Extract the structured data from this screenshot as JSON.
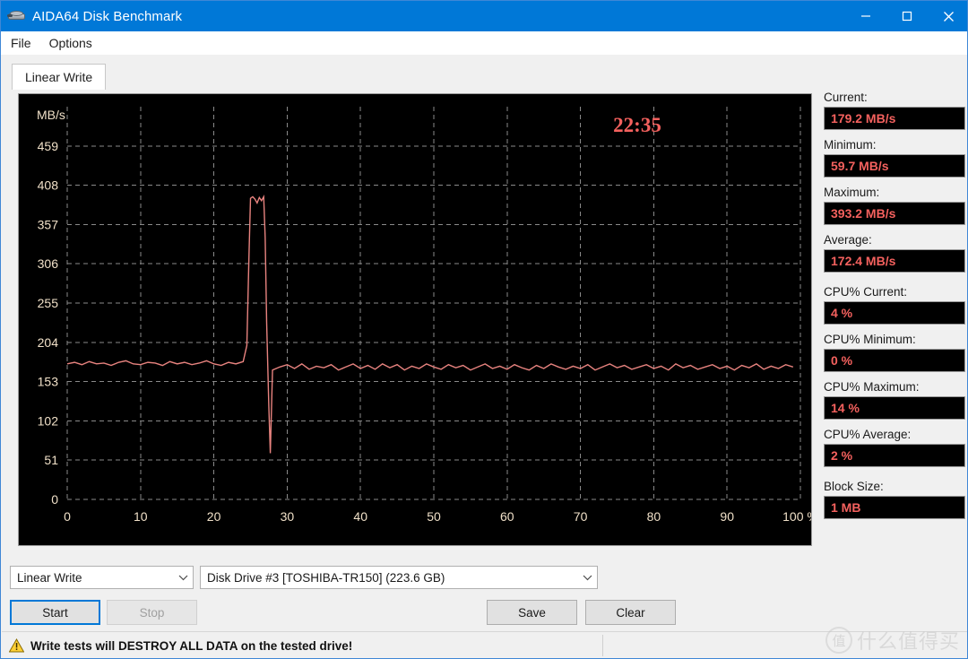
{
  "window": {
    "title": "AIDA64 Disk Benchmark",
    "icon": "disk-drive-icon",
    "minimize_label": "—",
    "maximize_label": "☐",
    "close_label": "✕",
    "titlebar_color": "#0078d7"
  },
  "menu": {
    "items": [
      {
        "label": "File"
      },
      {
        "label": "Options"
      }
    ]
  },
  "tabs": [
    {
      "label": "Linear Write",
      "active": true
    }
  ],
  "chart_data": {
    "type": "line",
    "title": "",
    "timer": "22:35",
    "xlabel": "",
    "ylabel": "MB/s",
    "x_unit": "%",
    "xlim": [
      0,
      100
    ],
    "ylim": [
      0,
      510
    ],
    "grid": true,
    "x_ticks": [
      0,
      10,
      20,
      30,
      40,
      50,
      60,
      70,
      80,
      90,
      100
    ],
    "x_tick_labels": [
      "0",
      "10",
      "20",
      "30",
      "40",
      "50",
      "60",
      "70",
      "80",
      "90",
      "100 %"
    ],
    "y_ticks": [
      0,
      51,
      102,
      153,
      204,
      255,
      306,
      357,
      408,
      459
    ],
    "y_tick_labels": [
      "0",
      "51",
      "102",
      "153",
      "204",
      "255",
      "306",
      "357",
      "408",
      "459"
    ],
    "line_color": "#e8837f",
    "background": "#000000",
    "grid_color": "#8a8a8a",
    "series": [
      {
        "name": "Linear Write",
        "x": [
          0,
          1,
          2,
          3,
          4,
          5,
          6,
          7,
          8,
          9,
          10,
          11,
          12,
          13,
          14,
          15,
          16,
          17,
          18,
          19,
          20,
          21,
          22,
          23,
          24,
          24.5,
          24.8,
          25.0,
          25.3,
          25.6,
          25.9,
          26.2,
          26.5,
          26.8,
          27.0,
          27.2,
          27.35,
          27.5,
          27.7,
          28,
          29,
          30,
          31,
          32,
          33,
          34,
          35,
          36,
          37,
          38,
          39,
          40,
          41,
          42,
          43,
          44,
          45,
          46,
          47,
          48,
          49,
          50,
          51,
          52,
          53,
          54,
          55,
          56,
          57,
          58,
          59,
          60,
          61,
          62,
          63,
          64,
          65,
          66,
          67,
          68,
          69,
          70,
          71,
          72,
          73,
          74,
          75,
          76,
          77,
          78,
          79,
          80,
          81,
          82,
          83,
          84,
          85,
          86,
          87,
          88,
          89,
          90,
          91,
          92,
          93,
          94,
          95,
          96,
          97,
          98,
          99,
          100
        ],
        "y": [
          176,
          178,
          175,
          179,
          176,
          177,
          174,
          178,
          180,
          176,
          175,
          178,
          177,
          174,
          179,
          176,
          178,
          175,
          177,
          180,
          176,
          174,
          178,
          176,
          179,
          200,
          320,
          391,
          393,
          390,
          385,
          392,
          388,
          393,
          340,
          230,
          175,
          120,
          60,
          168,
          172,
          175,
          170,
          176,
          169,
          173,
          171,
          175,
          168,
          172,
          176,
          170,
          174,
          169,
          176,
          171,
          175,
          168,
          173,
          170,
          176,
          172,
          169,
          175,
          171,
          174,
          168,
          172,
          176,
          170,
          173,
          169,
          175,
          171,
          168,
          174,
          170,
          176,
          172,
          169,
          173,
          170,
          175,
          168,
          172,
          176,
          171,
          174,
          169,
          172,
          175,
          170,
          173,
          168,
          176,
          171,
          174,
          169,
          172,
          175,
          170,
          173,
          168,
          174,
          171,
          176,
          169,
          173,
          170,
          175,
          172
        ]
      }
    ]
  },
  "sidebar": {
    "stats": [
      {
        "label": "Current:",
        "value": "179.2 MB/s",
        "name": "current"
      },
      {
        "label": "Minimum:",
        "value": "59.7 MB/s",
        "name": "minimum"
      },
      {
        "label": "Maximum:",
        "value": "393.2 MB/s",
        "name": "maximum"
      },
      {
        "label": "Average:",
        "value": "172.4 MB/s",
        "name": "average"
      },
      {
        "label": "CPU% Current:",
        "value": "4 %",
        "name": "cpu-current"
      },
      {
        "label": "CPU% Minimum:",
        "value": "0 %",
        "name": "cpu-minimum"
      },
      {
        "label": "CPU% Maximum:",
        "value": "14 %",
        "name": "cpu-maximum"
      },
      {
        "label": "CPU% Average:",
        "value": "2 %",
        "name": "cpu-average"
      },
      {
        "label": "Block Size:",
        "value": "1 MB",
        "name": "block-size"
      }
    ],
    "value_color": "#f4615e"
  },
  "controls": {
    "mode_select": {
      "value": "Linear Write"
    },
    "drive_select": {
      "value": "Disk Drive #3  [TOSHIBA-TR150]  (223.6 GB)"
    },
    "start_label": "Start",
    "stop_label": "Stop",
    "save_label": "Save",
    "clear_label": "Clear",
    "stop_disabled": true
  },
  "statusbar": {
    "warning_text": "Write tests will DESTROY ALL DATA on the tested drive!",
    "warning_icon": "warning-triangle-icon"
  },
  "watermark": {
    "badge": "值",
    "text": "什么值得买"
  }
}
